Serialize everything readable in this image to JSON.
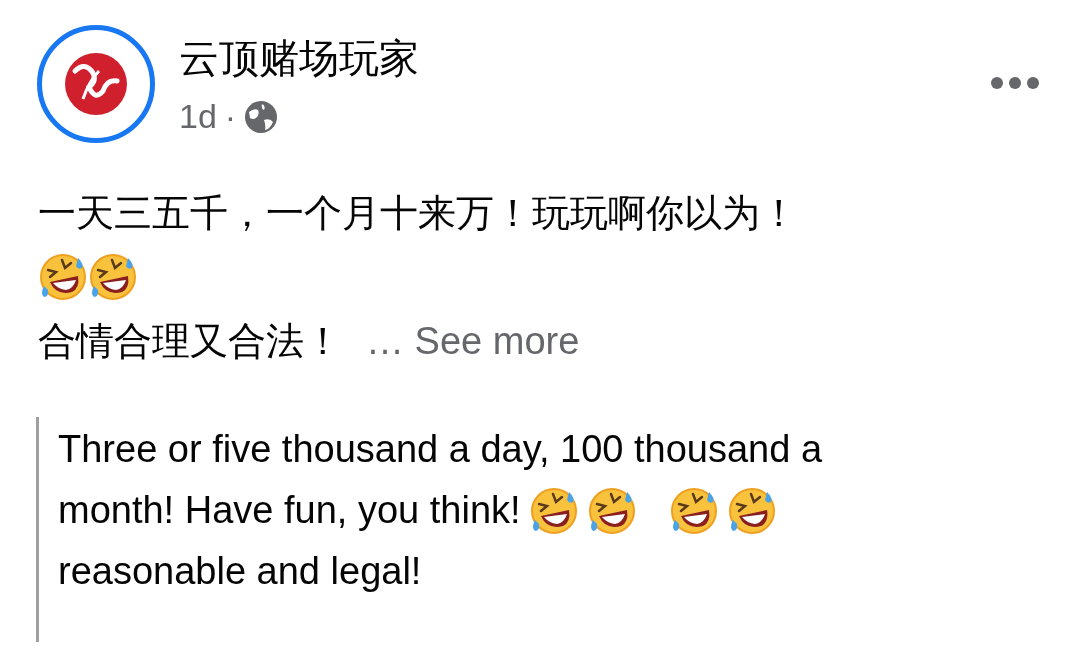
{
  "post": {
    "author": "云顶赌场玩家",
    "time": "1d",
    "separator": "·",
    "body": [
      [
        {
          "kind": "text",
          "text": "一天三五千，一个月十来万！玩玩啊你以为！"
        }
      ],
      [
        {
          "kind": "emoji"
        },
        {
          "kind": "emoji"
        }
      ],
      [
        {
          "kind": "text",
          "text": "合情合理又合法！"
        },
        {
          "kind": "more",
          "text": "… See more"
        }
      ]
    ],
    "translation": [
      [
        {
          "kind": "text",
          "text": "Three or five thousand a day, 100 thousand a"
        }
      ],
      [
        {
          "kind": "text",
          "text": "month! Have fun, you think!"
        },
        {
          "kind": "emoji"
        },
        {
          "kind": "emoji"
        },
        {
          "kind": "gap"
        },
        {
          "kind": "emoji"
        },
        {
          "kind": "emoji"
        }
      ],
      [
        {
          "kind": "text",
          "text": "reasonable and legal!"
        }
      ]
    ]
  }
}
